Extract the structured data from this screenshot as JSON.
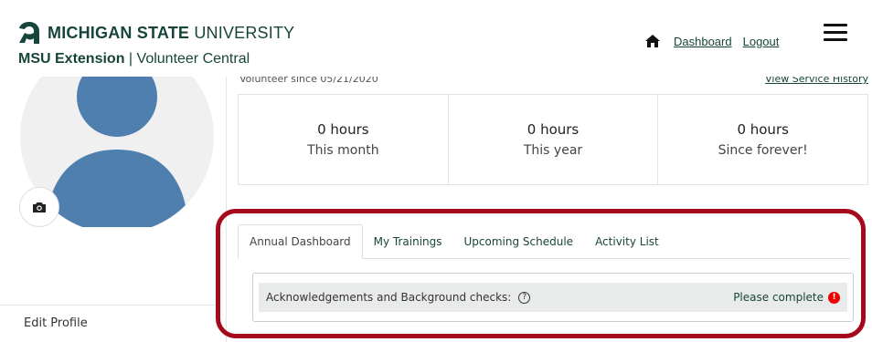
{
  "header": {
    "university_bold": "MICHIGAN STATE",
    "university_light": "UNIVERSITY",
    "org_bold": "MSU Extension",
    "org_rest": "| Volunteer Central",
    "nav": {
      "dashboard": "Dashboard",
      "logout": "Logout"
    },
    "icons": {
      "logo": "spartan-helmet-icon",
      "home": "home-icon",
      "menu": "hamburger-menu-icon"
    }
  },
  "sidebar": {
    "edit_profile": "Edit Profile",
    "icons": {
      "avatar": "user-avatar-icon",
      "camera": "camera-icon"
    }
  },
  "main": {
    "volunteer_since": "Volunteer since 05/21/2020",
    "service_history_link": "View Service History",
    "stats": [
      {
        "value": "0 hours",
        "label": "This month"
      },
      {
        "value": "0 hours",
        "label": "This year"
      },
      {
        "value": "0 hours",
        "label": "Since forever!"
      }
    ],
    "tabs": [
      {
        "label": "Annual Dashboard",
        "active": true
      },
      {
        "label": "My Trainings",
        "active": false
      },
      {
        "label": "Upcoming Schedule",
        "active": false
      },
      {
        "label": "Activity List",
        "active": false
      }
    ],
    "panel": {
      "title": "Acknowledgements and Background checks:",
      "help_glyph": "?",
      "status": "Please complete",
      "alert_glyph": "!"
    }
  },
  "colors": {
    "brand": "#18453b",
    "highlight": "#a6091c",
    "avatar": "#4f7fae",
    "alert": "#e00000"
  }
}
